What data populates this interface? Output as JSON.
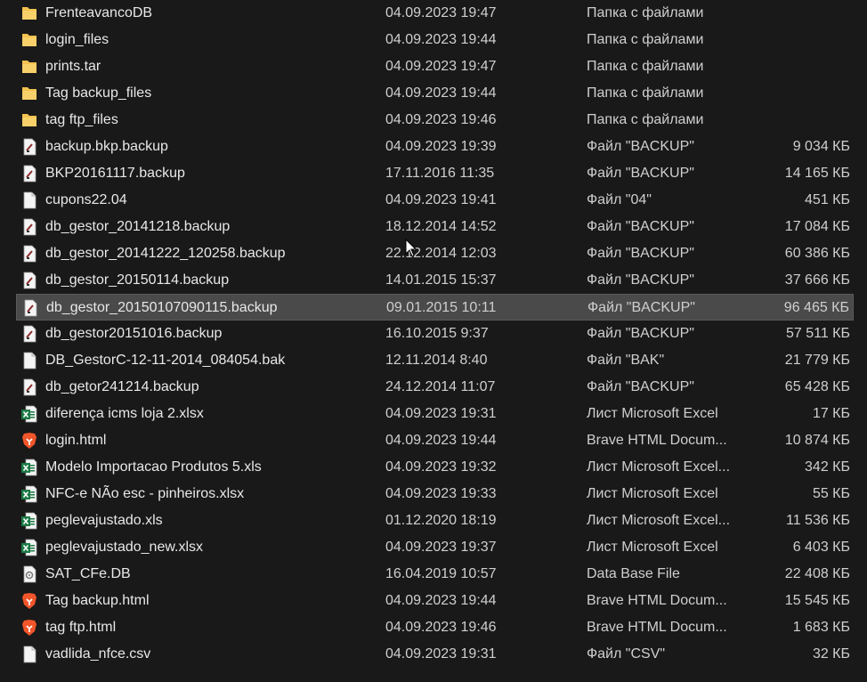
{
  "files": [
    {
      "name": "FrenteavancoDB",
      "date": "04.09.2023 19:47",
      "type": "Папка с файлами",
      "size": "",
      "icon": "folder-icon"
    },
    {
      "name": "login_files",
      "date": "04.09.2023 19:44",
      "type": "Папка с файлами",
      "size": "",
      "icon": "folder-icon"
    },
    {
      "name": "prints.tar",
      "date": "04.09.2023 19:47",
      "type": "Папка с файлами",
      "size": "",
      "icon": "folder-icon"
    },
    {
      "name": "Tag backup_files",
      "date": "04.09.2023 19:44",
      "type": "Папка с файлами",
      "size": "",
      "icon": "folder-icon"
    },
    {
      "name": "tag ftp_files",
      "date": "04.09.2023 19:46",
      "type": "Папка с файлами",
      "size": "",
      "icon": "folder-icon"
    },
    {
      "name": "backup.bkp.backup",
      "date": "04.09.2023 19:39",
      "type": "Файл \"BACKUP\"",
      "size": "9 034 КБ",
      "icon": "backup-file-icon"
    },
    {
      "name": "BKP20161117.backup",
      "date": "17.11.2016 11:35",
      "type": "Файл \"BACKUP\"",
      "size": "14 165 КБ",
      "icon": "backup-file-icon"
    },
    {
      "name": "cupons22.04",
      "date": "04.09.2023 19:41",
      "type": "Файл \"04\"",
      "size": "451 КБ",
      "icon": "blank-file-icon"
    },
    {
      "name": "db_gestor_20141218.backup",
      "date": "18.12.2014 14:52",
      "type": "Файл \"BACKUP\"",
      "size": "17 084 КБ",
      "icon": "backup-file-icon"
    },
    {
      "name": "db_gestor_20141222_120258.backup",
      "date": "22.12.2014 12:03",
      "type": "Файл \"BACKUP\"",
      "size": "60 386 КБ",
      "icon": "backup-file-icon"
    },
    {
      "name": "db_gestor_20150114.backup",
      "date": "14.01.2015 15:37",
      "type": "Файл \"BACKUP\"",
      "size": "37 666 КБ",
      "icon": "backup-file-icon"
    },
    {
      "name": "db_gestor_20150107090115.backup",
      "date": "09.01.2015 10:11",
      "type": "Файл \"BACKUP\"",
      "size": "96 465 КБ",
      "icon": "backup-file-icon",
      "selected": true
    },
    {
      "name": "db_gestor20151016.backup",
      "date": "16.10.2015 9:37",
      "type": "Файл \"BACKUP\"",
      "size": "57 511 КБ",
      "icon": "backup-file-icon"
    },
    {
      "name": "DB_GestorC-12-11-2014_084054.bak",
      "date": "12.11.2014 8:40",
      "type": "Файл \"BAK\"",
      "size": "21 779 КБ",
      "icon": "blank-file-icon"
    },
    {
      "name": "db_getor241214.backup",
      "date": "24.12.2014 11:07",
      "type": "Файл \"BACKUP\"",
      "size": "65 428 КБ",
      "icon": "backup-file-icon"
    },
    {
      "name": "diferença icms loja 2.xlsx",
      "date": "04.09.2023 19:31",
      "type": "Лист Microsoft Excel",
      "size": "17 КБ",
      "icon": "excel-icon"
    },
    {
      "name": "login.html",
      "date": "04.09.2023 19:44",
      "type": "Brave HTML Docum...",
      "size": "10 874 КБ",
      "icon": "brave-icon"
    },
    {
      "name": "Modelo Importacao Produtos 5.xls",
      "date": "04.09.2023 19:32",
      "type": "Лист Microsoft Excel...",
      "size": "342 КБ",
      "icon": "excel-icon"
    },
    {
      "name": "NFC-e NÃo esc - pinheiros.xlsx",
      "date": "04.09.2023 19:33",
      "type": "Лист Microsoft Excel",
      "size": "55 КБ",
      "icon": "excel-icon"
    },
    {
      "name": "peglevajustado.xls",
      "date": "01.12.2020 18:19",
      "type": "Лист Microsoft Excel...",
      "size": "11 536 КБ",
      "icon": "excel-icon"
    },
    {
      "name": "peglevajustado_new.xlsx",
      "date": "04.09.2023 19:37",
      "type": "Лист Microsoft Excel",
      "size": "6 403 КБ",
      "icon": "excel-icon"
    },
    {
      "name": "SAT_CFe.DB",
      "date": "16.04.2019 10:57",
      "type": "Data Base File",
      "size": "22 408 КБ",
      "icon": "database-file-icon"
    },
    {
      "name": "Tag backup.html",
      "date": "04.09.2023 19:44",
      "type": "Brave HTML Docum...",
      "size": "15 545 КБ",
      "icon": "brave-icon"
    },
    {
      "name": "tag ftp.html",
      "date": "04.09.2023 19:46",
      "type": "Brave HTML Docum...",
      "size": "1 683 КБ",
      "icon": "brave-icon"
    },
    {
      "name": "vadlida_nfce.csv",
      "date": "04.09.2023 19:31",
      "type": "Файл \"CSV\"",
      "size": "32 КБ",
      "icon": "blank-file-icon"
    }
  ],
  "colors": {
    "background": "#191919",
    "selected": "#4a4a4a",
    "folder": "#f3c24f",
    "excel": "#1d7a45",
    "brave": "#f1562b"
  }
}
